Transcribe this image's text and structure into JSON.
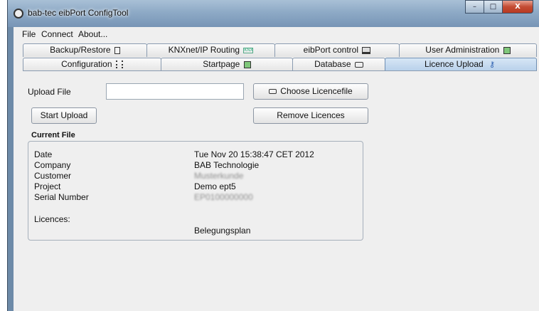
{
  "window": {
    "title": "bab-tec eibPort ConfigTool",
    "controls": {
      "minimize": "–",
      "maximize": "□",
      "close": "X"
    }
  },
  "menu": [
    "File",
    "Connect",
    "About..."
  ],
  "tabs": {
    "row1": [
      {
        "label": "Backup/Restore",
        "icon": "archive-icon"
      },
      {
        "label": "KNXnet/IP Routing",
        "icon": "knx-icon"
      },
      {
        "label": "eibPort control",
        "icon": "monitor-icon"
      },
      {
        "label": "User Administration",
        "icon": "users-icon"
      }
    ],
    "row2": [
      {
        "label": "Configuration",
        "icon": "config-icon"
      },
      {
        "label": "Startpage",
        "icon": "startpage-icon"
      },
      {
        "label": "Database",
        "icon": "database-icon"
      },
      {
        "label": "Licence Upload",
        "icon": "key-icon",
        "selected": true
      }
    ]
  },
  "upload": {
    "label": "Upload File",
    "file_value": "",
    "choose_button": "Choose Licencefile",
    "start_button": "Start Upload",
    "remove_button": "Remove Licences"
  },
  "current_file": {
    "title": "Current File",
    "fields": [
      {
        "key": "Date",
        "value": "Tue Nov 20 15:38:47 CET 2012"
      },
      {
        "key": "Company",
        "value": "BAB Technologie"
      },
      {
        "key": "Customer",
        "value": "Musterkunde"
      },
      {
        "key": "Project",
        "value": "Demo ept5"
      },
      {
        "key": "Serial Number",
        "value": "EP0100000000"
      }
    ],
    "licences_label": "Licences:",
    "licences": [
      "Belegungsplan"
    ]
  }
}
